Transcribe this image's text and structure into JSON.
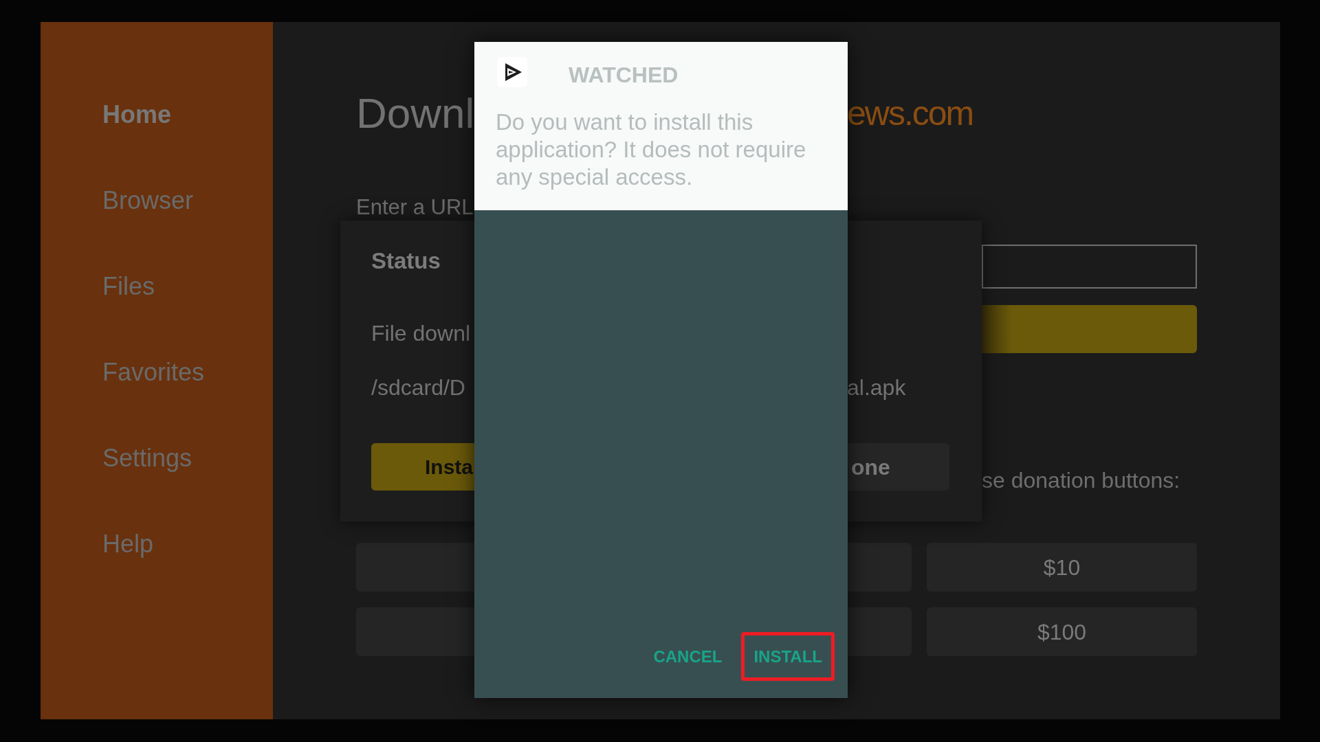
{
  "sidebar": {
    "items": [
      {
        "label": "Home",
        "selected": true
      },
      {
        "label": "Browser",
        "selected": false
      },
      {
        "label": "Files",
        "selected": false
      },
      {
        "label": "Favorites",
        "selected": false
      },
      {
        "label": "Settings",
        "selected": false
      },
      {
        "label": "Help",
        "selected": false
      }
    ]
  },
  "main": {
    "title": {
      "left_part": "Downl",
      "right_part": "ews.com"
    },
    "url_label": "Enter a URL",
    "donation_text": "se donation buttons:",
    "donation_buttons": [
      {
        "label": "$10"
      },
      {
        "label": "$100"
      }
    ]
  },
  "status_dialog": {
    "title": "Status",
    "message": "File downl",
    "path_left": "/sdcard/D",
    "path_right": "al.apk",
    "buttons": [
      {
        "label": "Insta",
        "kind": "primary"
      },
      {
        "label": "one",
        "kind": "secondary"
      }
    ]
  },
  "install_dialog": {
    "app_name": "WATCHED",
    "message": "Do you want to install this application? It does not require any special access.",
    "buttons": [
      {
        "label": "CANCEL",
        "highlighted": false
      },
      {
        "label": "INSTALL",
        "highlighted": true
      }
    ]
  }
}
